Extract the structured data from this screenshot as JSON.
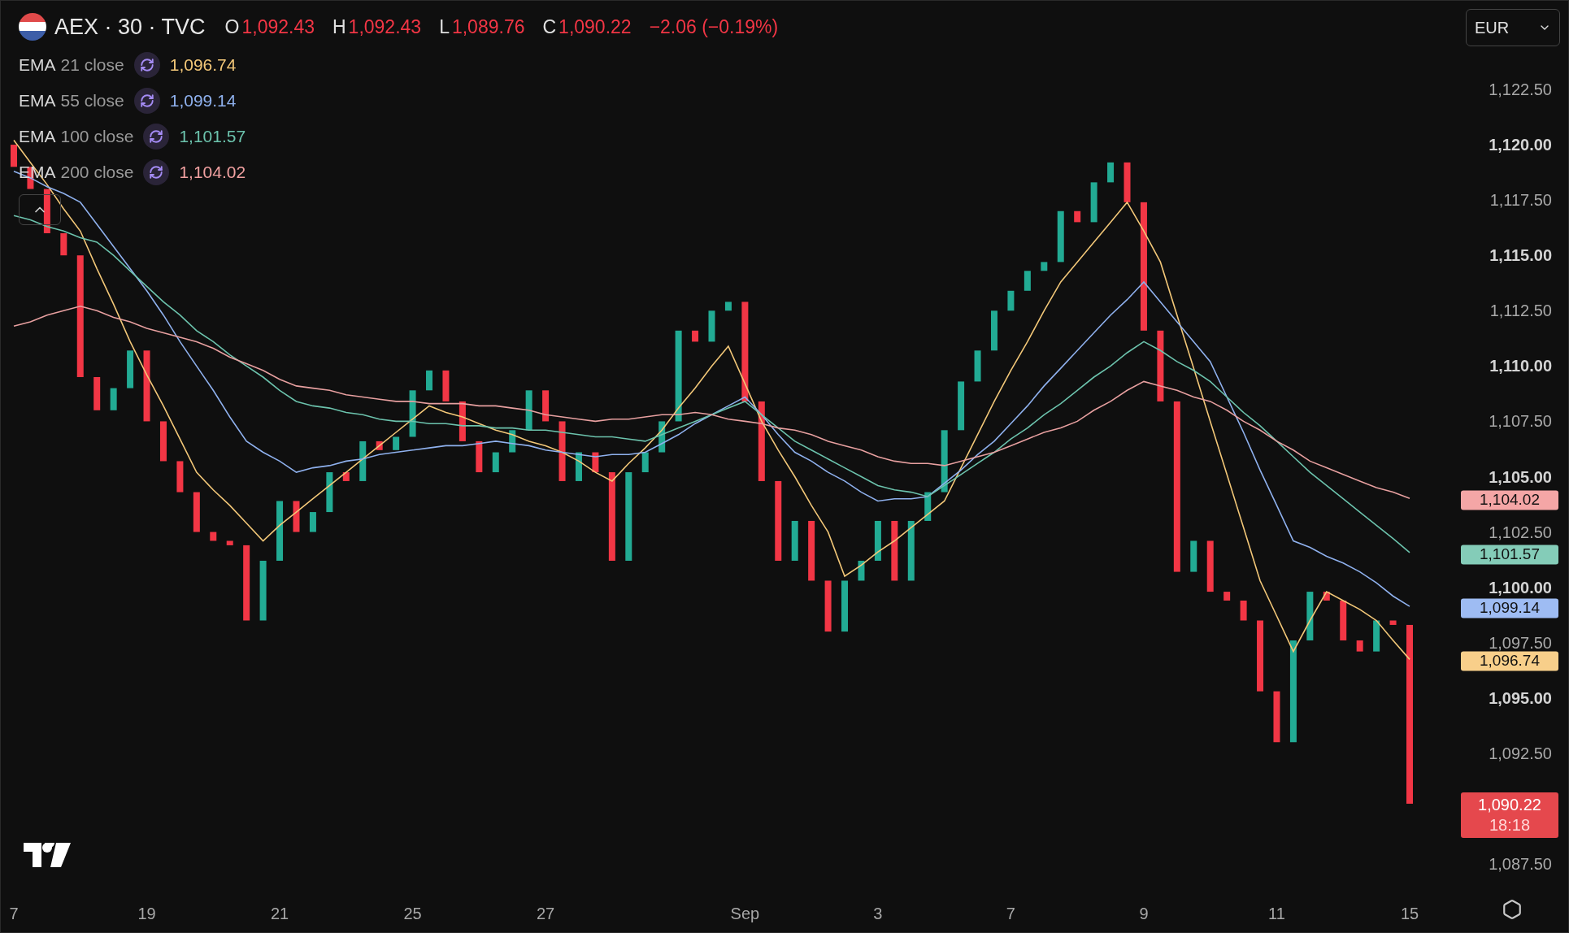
{
  "header": {
    "symbol": "AEX · 30 · TVC",
    "ohlc": [
      {
        "label": "O",
        "value": "1,092.43"
      },
      {
        "label": "H",
        "value": "1,092.43"
      },
      {
        "label": "L",
        "value": "1,089.76"
      },
      {
        "label": "C",
        "value": "1,090.22"
      }
    ],
    "change": "−2.06 (−0.19%)"
  },
  "currency": {
    "value": "EUR"
  },
  "indicators": [
    {
      "name": "EMA",
      "params": "21 close",
      "value": "1,096.74",
      "color": "#f2c778"
    },
    {
      "name": "EMA",
      "params": "55 close",
      "value": "1,099.14",
      "color": "#8fb1ee"
    },
    {
      "name": "EMA",
      "params": "100 close",
      "value": "1,101.57",
      "color": "#6cc3ad"
    },
    {
      "name": "EMA",
      "params": "200 close",
      "value": "1,104.02",
      "color": "#f0a0a0"
    }
  ],
  "chart_data": {
    "type": "line",
    "ylim": [
      1087.5,
      1122.5
    ],
    "categories": [
      "7",
      null,
      null,
      null,
      null,
      null,
      null,
      null,
      "19",
      null,
      null,
      null,
      null,
      null,
      null,
      null,
      "21",
      null,
      null,
      null,
      null,
      null,
      null,
      null,
      "25",
      null,
      null,
      null,
      null,
      null,
      null,
      null,
      "27",
      null,
      null,
      null,
      null,
      null,
      null,
      null,
      null,
      null,
      null,
      null,
      "Sep",
      null,
      null,
      null,
      null,
      null,
      null,
      null,
      "3",
      null,
      null,
      null,
      null,
      null,
      null,
      null,
      "7",
      null,
      null,
      null,
      null,
      null,
      null,
      null,
      "9",
      null,
      null,
      null,
      null,
      null,
      null,
      null,
      "11",
      null,
      null,
      null,
      null,
      null,
      null,
      null,
      "15"
    ],
    "yticks": [
      {
        "value": 1122.5,
        "label": "1,122.50"
      },
      {
        "value": 1120,
        "label": "1,120.00"
      },
      {
        "value": 1117.5,
        "label": "1,117.50"
      },
      {
        "value": 1115,
        "label": "1,115.00"
      },
      {
        "value": 1112.5,
        "label": "1,112.50"
      },
      {
        "value": 1110,
        "label": "1,110.00"
      },
      {
        "value": 1107.5,
        "label": "1,107.50"
      },
      {
        "value": 1105,
        "label": "1,105.00"
      },
      {
        "value": 1102.5,
        "label": "1,102.50"
      },
      {
        "value": 1100,
        "label": "1,100.00"
      },
      {
        "value": 1097.5,
        "label": "1,097.50"
      },
      {
        "value": 1095,
        "label": "1,095.00"
      },
      {
        "value": 1092.5,
        "label": "1,092.50"
      },
      {
        "value": 1087.5,
        "label": "1,087.50"
      }
    ],
    "series": [
      {
        "color": "#f2c778",
        "values": [
          1120.2,
          1119.2,
          1118.2,
          1117.1,
          1116.1,
          1114.4,
          1112.8,
          1111.1,
          1109.6,
          1108.2,
          1106.7,
          1105.2,
          1104.4,
          1103.7,
          1102.9,
          1102.1,
          1102.8,
          1103.4,
          1104.0,
          1104.6,
          1105.2,
          1105.8,
          1106.4,
          1107.0,
          1107.6,
          1108.2,
          1107.9,
          1107.7,
          1107.4,
          1107.1,
          1106.9,
          1106.6,
          1106.4,
          1106.1,
          1105.7,
          1105.2,
          1104.8,
          1105.6,
          1106.3,
          1107.1,
          1108.1,
          1109.0,
          1110.0,
          1110.9,
          1109.2,
          1107.5,
          1106.2,
          1105.0,
          1103.7,
          1102.5,
          1100.5,
          1101.0,
          1101.6,
          1102.1,
          1102.7,
          1103.3,
          1103.9,
          1105.4,
          1106.9,
          1108.4,
          1109.8,
          1111.1,
          1112.5,
          1113.8,
          1114.7,
          1115.6,
          1116.5,
          1117.4,
          1116.1,
          1114.7,
          1112.3,
          1109.9,
          1107.5,
          1105.1,
          1102.7,
          1100.3,
          1098.7,
          1097.1,
          1098.5,
          1099.8,
          1099.4,
          1099.0,
          1098.5,
          1097.6,
          1096.74
        ]
      },
      {
        "color": "#8fb1ee",
        "values": [
          1118.8,
          1118.5,
          1118.1,
          1117.8,
          1117.4,
          1116.4,
          1115.4,
          1114.4,
          1113.4,
          1112.3,
          1111.1,
          1110.0,
          1108.9,
          1107.7,
          1106.6,
          1106.1,
          1105.7,
          1105.2,
          1105.4,
          1105.5,
          1105.7,
          1105.8,
          1106.0,
          1106.1,
          1106.2,
          1106.3,
          1106.4,
          1106.4,
          1106.5,
          1106.6,
          1106.5,
          1106.4,
          1106.2,
          1106.1,
          1106.0,
          1105.9,
          1106.0,
          1106.0,
          1106.1,
          1106.5,
          1106.9,
          1107.4,
          1107.8,
          1108.2,
          1108.6,
          1107.8,
          1106.9,
          1106.1,
          1105.7,
          1105.2,
          1104.8,
          1104.3,
          1103.9,
          1104.0,
          1104.0,
          1104.1,
          1104.7,
          1105.3,
          1106.0,
          1106.6,
          1107.4,
          1108.2,
          1109.1,
          1109.9,
          1110.7,
          1111.5,
          1112.3,
          1113.0,
          1113.8,
          1112.9,
          1112.0,
          1111.1,
          1110.2,
          1108.6,
          1107.0,
          1105.3,
          1103.7,
          1102.1,
          1101.8,
          1101.4,
          1101.1,
          1100.7,
          1100.2,
          1099.6,
          1099.14
        ]
      },
      {
        "color": "#6cc3ad",
        "values": [
          1116.8,
          1116.6,
          1116.3,
          1116.1,
          1115.8,
          1115.6,
          1115.0,
          1114.3,
          1113.6,
          1112.9,
          1112.3,
          1111.6,
          1111.1,
          1110.5,
          1110.0,
          1109.5,
          1108.9,
          1108.4,
          1108.2,
          1108.1,
          1107.9,
          1107.8,
          1107.6,
          1107.5,
          1107.5,
          1107.4,
          1107.4,
          1107.3,
          1107.3,
          1107.2,
          1107.2,
          1107.1,
          1107.1,
          1107.0,
          1106.9,
          1106.8,
          1106.8,
          1106.7,
          1106.6,
          1106.9,
          1107.2,
          1107.5,
          1107.8,
          1108.1,
          1108.4,
          1107.8,
          1107.2,
          1106.6,
          1106.2,
          1105.8,
          1105.4,
          1105.0,
          1104.6,
          1104.4,
          1104.3,
          1104.1,
          1104.6,
          1105.1,
          1105.6,
          1106.1,
          1106.7,
          1107.2,
          1107.8,
          1108.3,
          1108.9,
          1109.5,
          1110.0,
          1110.6,
          1111.1,
          1110.7,
          1110.2,
          1109.8,
          1109.3,
          1108.6,
          1107.9,
          1107.3,
          1106.6,
          1105.9,
          1105.2,
          1104.6,
          1104.0,
          1103.4,
          1102.8,
          1102.2,
          1101.57
        ]
      },
      {
        "color": "#e8a0a0",
        "values": [
          1111.8,
          1112.0,
          1112.3,
          1112.5,
          1112.7,
          1112.5,
          1112.2,
          1112.0,
          1111.7,
          1111.5,
          1111.3,
          1111.1,
          1110.8,
          1110.4,
          1110.1,
          1109.8,
          1109.4,
          1109.1,
          1109.0,
          1108.9,
          1108.7,
          1108.6,
          1108.5,
          1108.4,
          1108.4,
          1108.3,
          1108.3,
          1108.3,
          1108.2,
          1108.2,
          1108.1,
          1108.0,
          1107.8,
          1107.7,
          1107.6,
          1107.5,
          1107.6,
          1107.6,
          1107.7,
          1107.8,
          1107.8,
          1107.9,
          1107.8,
          1107.6,
          1107.5,
          1107.4,
          1107.2,
          1107.1,
          1106.9,
          1106.6,
          1106.4,
          1106.2,
          1105.9,
          1105.7,
          1105.6,
          1105.6,
          1105.5,
          1105.7,
          1105.9,
          1106.1,
          1106.4,
          1106.7,
          1107.0,
          1107.2,
          1107.5,
          1108.0,
          1108.4,
          1108.9,
          1109.3,
          1109.1,
          1108.9,
          1108.6,
          1108.4,
          1108.0,
          1107.5,
          1107.1,
          1106.6,
          1106.2,
          1105.7,
          1105.4,
          1105.1,
          1104.8,
          1104.5,
          1104.3,
          1104.02
        ]
      }
    ]
  },
  "price_labels": [
    {
      "text": "1,104.02",
      "color": "#f4a6a6"
    },
    {
      "text": "1,101.57",
      "color": "#84ccb8"
    },
    {
      "text": "1,099.14",
      "color": "#9ebcf3"
    },
    {
      "text": "1,096.74",
      "color": "#f8cf8a"
    }
  ],
  "last_price": {
    "price": "1,090.22",
    "countdown": "18:18",
    "color": "#e5484d"
  }
}
